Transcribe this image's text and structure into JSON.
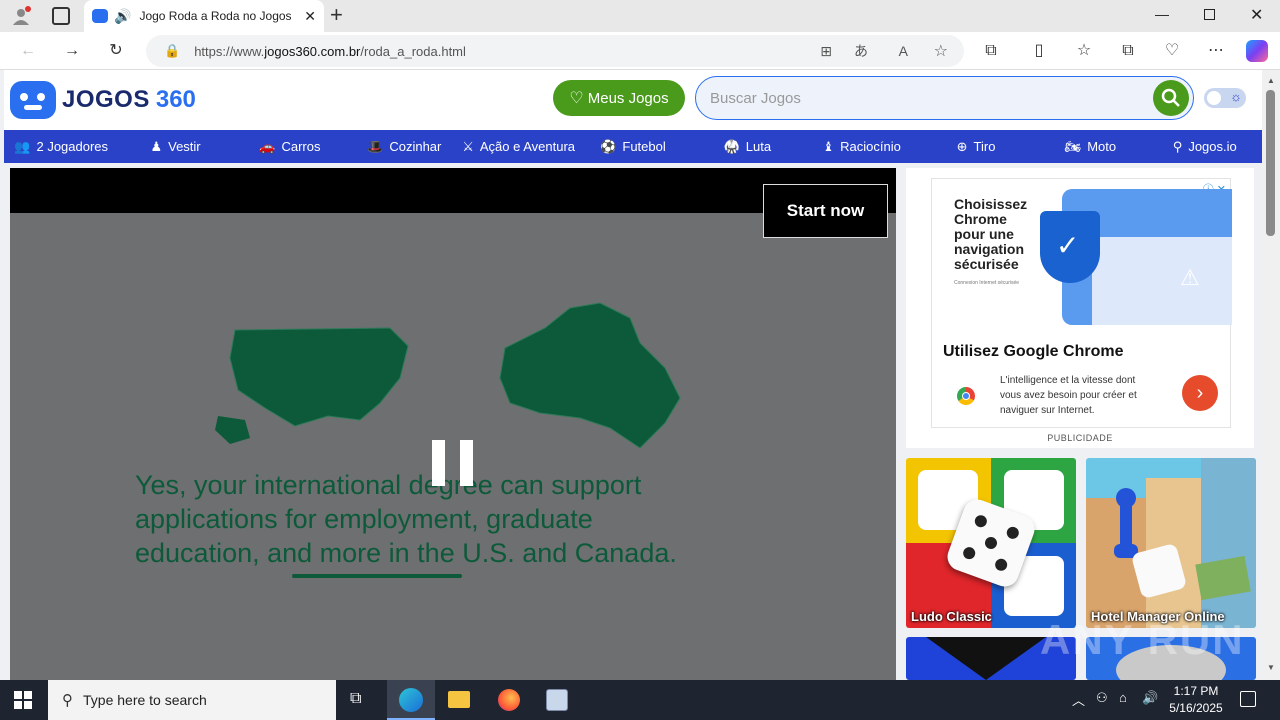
{
  "browser": {
    "tab_title": "Jogo Roda a Roda no Jogos",
    "url_prefix": "https://www.",
    "url_domain": "jogos360.com.br",
    "url_path": "/roda_a_roda.html"
  },
  "site": {
    "logo_text": "JOGOS",
    "logo_num": "360",
    "my_games_label": "Meus Jogos",
    "search_placeholder": "Buscar Jogos"
  },
  "nav": [
    {
      "label": "2 Jogadores",
      "icon": "users-icon"
    },
    {
      "label": "Vestir",
      "icon": "dress-icon"
    },
    {
      "label": "Carros",
      "icon": "car-icon"
    },
    {
      "label": "Cozinhar",
      "icon": "chef-hat-icon"
    },
    {
      "label": "Ação e Aventura",
      "icon": "action-icon"
    },
    {
      "label": "Futebol",
      "icon": "soccer-ball-icon"
    },
    {
      "label": "Luta",
      "icon": "fighter-icon"
    },
    {
      "label": "Raciocínio",
      "icon": "chess-icon"
    },
    {
      "label": "Tiro",
      "icon": "crosshair-icon"
    },
    {
      "label": "Moto",
      "icon": "motorcycle-icon"
    },
    {
      "label": "Jogos.io",
      "icon": "io-icon"
    }
  ],
  "game_ad": {
    "start_now": "Start now",
    "text_line1": "Yes, your international degree can support",
    "text_line2": "applications for employment, graduate",
    "text_line3": "education, and more in the U.S. and Canada."
  },
  "side_ad": {
    "headline_1": "Choisissez",
    "headline_2": "Chrome",
    "headline_3": "pour une",
    "headline_4": "navigation",
    "headline_5": "sécurisée",
    "tiny": "Connexion Internet sécurisée",
    "title": "Utilisez Google Chrome",
    "body_1": "L'intelligence et la vitesse dont",
    "body_2": "vous avez besoin pour créer et",
    "body_3": "naviguer sur Internet.",
    "publicidade": "PUBLICIDADE"
  },
  "thumbs": [
    {
      "label": "Ludo Classic"
    },
    {
      "label": "Hotel Manager Online"
    }
  ],
  "taskbar": {
    "search_placeholder": "Type here to search",
    "time": "1:17 PM",
    "date": "5/16/2025"
  },
  "watermark": "ANY RUN"
}
